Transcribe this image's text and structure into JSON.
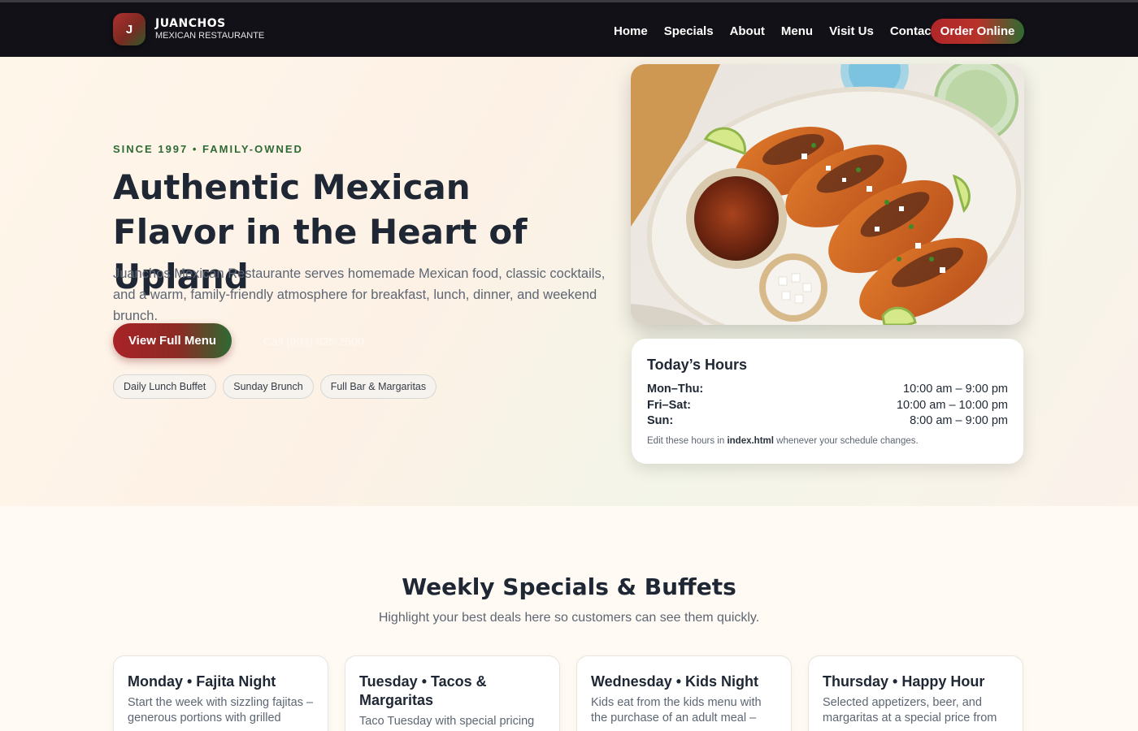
{
  "brand": {
    "mark": "J",
    "name": "JUANCHOS",
    "subtitle": "MEXICAN RESTAURANTE"
  },
  "nav": {
    "links": [
      "Home",
      "Specials",
      "About",
      "Menu",
      "Visit Us",
      "Contact"
    ],
    "order_label": "Order Online"
  },
  "hero": {
    "eyebrow": "SINCE 1997 • FAMILY-OWNED",
    "title": "Authentic Mexican Flavor in the Heart of Upland",
    "lead": "Juanchos Mexican Restaurante serves homemade Mexican food, classic cocktails, and a warm, family-friendly atmosphere for breakfast, lunch, dinner, and weekend brunch.",
    "menu_button": "View Full Menu",
    "call_button": "Call (909) 625-2500",
    "chips": [
      "Daily Lunch Buffet",
      "Sunday Brunch",
      "Full Bar & Margaritas"
    ]
  },
  "hours": {
    "title": "Today’s Hours",
    "rows": [
      {
        "day": "Mon–Thu:",
        "time": "10:00 am – 9:00 pm"
      },
      {
        "day": "Fri–Sat:",
        "time": "10:00 am – 10:00 pm"
      },
      {
        "day": "Sun:",
        "time": "8:00 am – 9:00 pm"
      }
    ],
    "note_prefix": "Edit these hours in ",
    "note_file": "index.html",
    "note_suffix": " whenever your schedule changes."
  },
  "specials": {
    "title": "Weekly Specials & Buffets",
    "subtitle": "Highlight your best deals here so customers can see them quickly.",
    "cards": [
      {
        "title": "Monday • Fajita Night",
        "text": "Start the week with sizzling fajitas – generous portions with grilled"
      },
      {
        "title": "Tuesday • Tacos & Margaritas",
        "text": "Taco Tuesday with special pricing"
      },
      {
        "title": "Wednesday • Kids Night",
        "text": "Kids eat from the kids menu with the purchase of an adult meal –"
      },
      {
        "title": "Thursday • Happy Hour",
        "text": "Selected appetizers, beer, and margaritas at a special price from"
      }
    ]
  },
  "colors": {
    "nav_bg": "#111117",
    "accent_red": "#a82327",
    "accent_green": "#2e6a34",
    "page_bg": "#fffaf3"
  }
}
